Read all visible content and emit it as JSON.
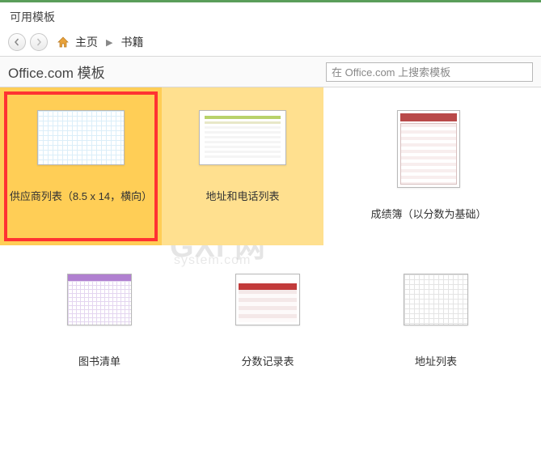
{
  "header": {
    "title": "可用模板"
  },
  "nav": {
    "home_label": "主页",
    "crumb2": "书籍"
  },
  "section": {
    "title": "Office.com 模板",
    "search_placeholder": "在 Office.com 上搜索模板"
  },
  "templates_row1": [
    {
      "label": "供应商列表（8.5 x 14，横向）"
    },
    {
      "label": "地址和电话列表"
    },
    {
      "label": "成绩簿（以分数为基础）"
    }
  ],
  "templates_row2": [
    {
      "label": "图书清单"
    },
    {
      "label": "分数记录表"
    },
    {
      "label": "地址列表"
    }
  ],
  "watermark": {
    "line1": "GXI 网",
    "line2": "system.com"
  }
}
